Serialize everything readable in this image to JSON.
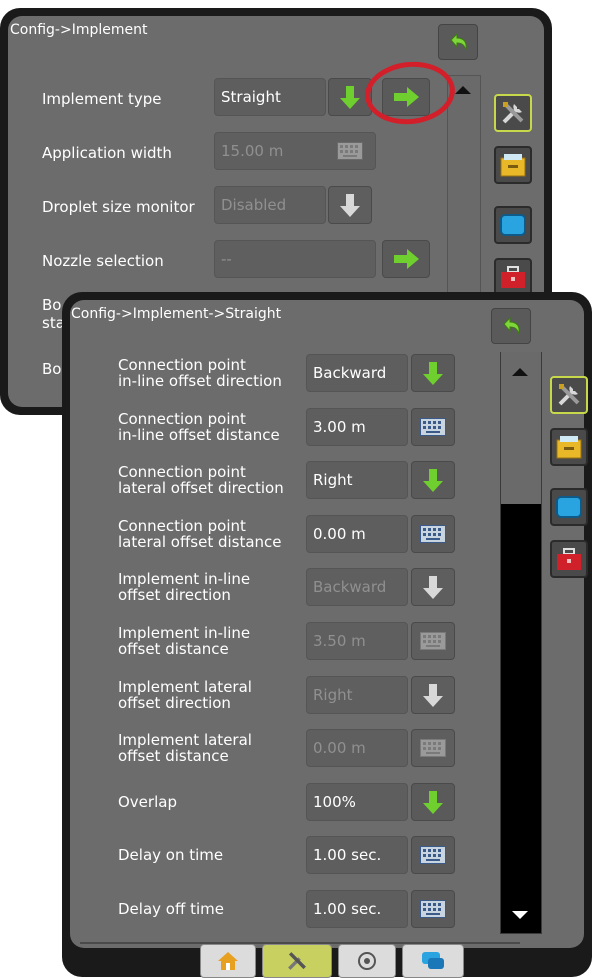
{
  "back_panel": {
    "breadcrumb": "Config->Implement",
    "rows": [
      {
        "label": "Implement type",
        "value": "Straight",
        "state": "enabled"
      },
      {
        "label": "Application width",
        "value": "15.00 m",
        "state": "disabled"
      },
      {
        "label": "Droplet size monitor",
        "value": "Disabled",
        "state": "disabled"
      },
      {
        "label": "Nozzle selection",
        "value": "--",
        "state": "disabled"
      },
      {
        "label": "Bo"
      },
      {
        "label": "sta"
      },
      {
        "label": "Bo"
      }
    ]
  },
  "front_panel": {
    "breadcrumb": "Config->Implement->Straight",
    "rows": [
      {
        "label": "Connection point\nin-line offset direction",
        "value": "Backward",
        "control": "dropdown",
        "state": "enabled"
      },
      {
        "label": "Connection point\nin-line offset distance",
        "value": "3.00 m",
        "control": "keypad",
        "state": "enabled"
      },
      {
        "label": "Connection point\nlateral offset direction",
        "value": "Right",
        "control": "dropdown",
        "state": "enabled"
      },
      {
        "label": "Connection point\nlateral offset distance",
        "value": "0.00 m",
        "control": "keypad",
        "state": "enabled"
      },
      {
        "label": "Implement in-line\noffset direction",
        "value": "Backward",
        "control": "dropdown",
        "state": "disabled"
      },
      {
        "label": "Implement in-line\noffset distance",
        "value": "3.50 m",
        "control": "keypad",
        "state": "disabled"
      },
      {
        "label": "Implement lateral\noffset direction",
        "value": "Right",
        "control": "dropdown",
        "state": "disabled"
      },
      {
        "label": "Implement lateral\noffset distance",
        "value": "0.00 m",
        "control": "keypad",
        "state": "disabled"
      },
      {
        "label": "Overlap",
        "value": "100%",
        "control": "dropdown",
        "state": "enabled"
      },
      {
        "label": "Delay on time",
        "value": "1.00 sec.",
        "control": "keypad",
        "state": "enabled"
      },
      {
        "label": "Delay off time",
        "value": "1.00 sec.",
        "control": "keypad",
        "state": "enabled"
      }
    ]
  },
  "side_tabs": [
    "tools-icon",
    "console-icon",
    "screen-icon",
    "toolbox-icon"
  ],
  "bottom_nav": [
    "home-icon",
    "tools-icon",
    "gps-icon",
    "chat-icon"
  ],
  "colors": {
    "accent_green": "#6fcf2e",
    "highlight_ring": "#d21f2a",
    "selected_tab": "#c7d94a"
  }
}
